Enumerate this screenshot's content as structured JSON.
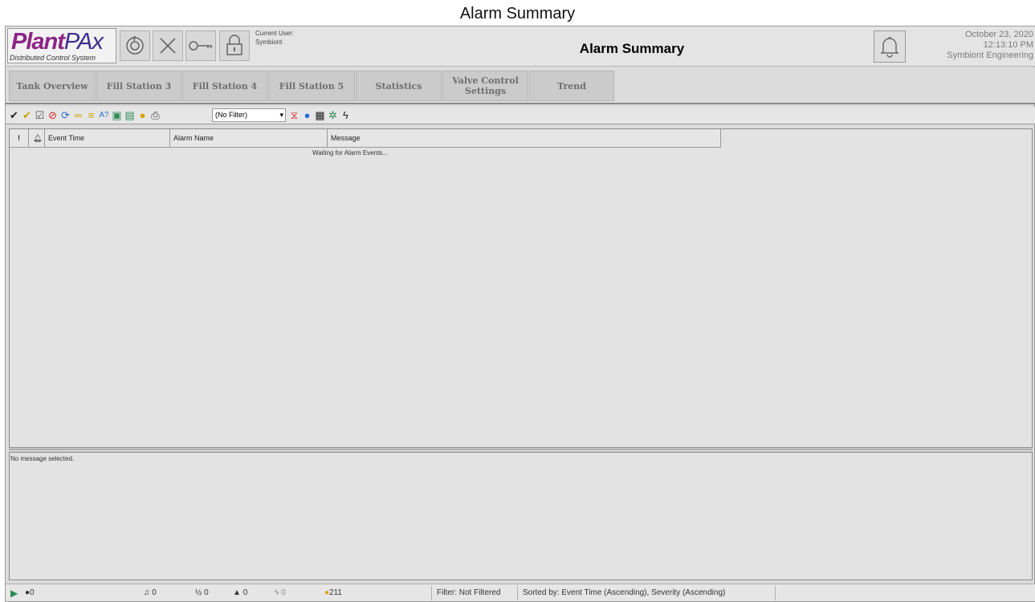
{
  "page_title": "Alarm Summary",
  "logo": {
    "plant": "Plant",
    "pax": "PAx",
    "subtitle": "Distributed Control System"
  },
  "header": {
    "user_label": "Current User:",
    "user_name": "Symbiont",
    "title": "Alarm Summary",
    "date": "October 23, 2020",
    "time": "12:13:10 PM",
    "company": "Symbiont Engineering"
  },
  "nav": {
    "items": [
      {
        "label": "Tank Overview"
      },
      {
        "label": "Fill Station 3"
      },
      {
        "label": "Fill Station 4"
      },
      {
        "label": "Fill Station 5"
      },
      {
        "label": "Statistics"
      },
      {
        "label": "Valve Control Settings"
      },
      {
        "label": "Trend"
      }
    ]
  },
  "toolbar": {
    "filter_value": "(No Filter)"
  },
  "grid": {
    "columns": [
      "!",
      "",
      "Event Time",
      "Alarm Name",
      "Message"
    ],
    "empty_message": "Waiting for Alarm Events..."
  },
  "detail": {
    "text": "No message selected."
  },
  "status": {
    "count_0": "0",
    "count_1": "0",
    "count_2": "0",
    "count_3": "0",
    "count_4": "0",
    "count_5": "211",
    "filter": "Filter: Not Filtered",
    "sorted": "Sorted by: Event Time (Ascending), Severity (Ascending)"
  },
  "colors": {
    "accent_plant": "#8d2486",
    "accent_pax": "#3f2d8f"
  }
}
